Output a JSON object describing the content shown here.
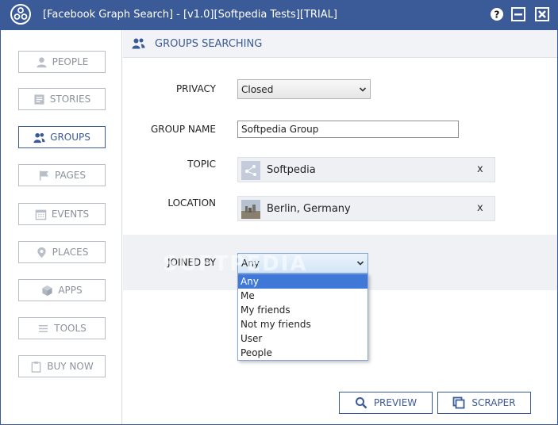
{
  "window": {
    "title": "[Facebook Graph Search] - [v1.0][Softpedia Tests][TRIAL]",
    "accent": "#3b5a98"
  },
  "sidebar": {
    "items": [
      {
        "label": "PEOPLE",
        "icon": "person-icon",
        "active": false
      },
      {
        "label": "STORIES",
        "icon": "stories-icon",
        "active": false
      },
      {
        "label": "GROUPS",
        "icon": "groups-icon",
        "active": true
      },
      {
        "label": "PAGES",
        "icon": "flag-icon",
        "active": false
      },
      {
        "label": "EVENTS",
        "icon": "calendar-icon",
        "active": false
      },
      {
        "label": "PLACES",
        "icon": "location-pin-icon",
        "active": false
      },
      {
        "label": "APPS",
        "icon": "cube-icon",
        "active": false
      },
      {
        "label": "TOOLS",
        "icon": "list-icon",
        "active": false
      },
      {
        "label": "BUY NOW",
        "icon": "clipboard-icon",
        "active": false
      }
    ]
  },
  "header": {
    "title": "GROUPS SEARCHING"
  },
  "form": {
    "privacy": {
      "label": "PRIVACY",
      "value": "Closed"
    },
    "group_name": {
      "label": "GROUP NAME",
      "value": "Softpedia Group"
    },
    "topic": {
      "label": "TOPIC",
      "value": "Softpedia",
      "remove": "x"
    },
    "location": {
      "label": "LOCATION",
      "value": "Berlin, Germany",
      "remove": "x"
    },
    "joined_by": {
      "label": "JOINED BY",
      "value": "Any",
      "options": [
        "Any",
        "Me",
        "My friends",
        "Not my friends",
        "User",
        "People"
      ]
    }
  },
  "watermark": "SOFTPEDIA",
  "actions": {
    "preview": "PREVIEW",
    "scraper": "SCRAPER"
  }
}
